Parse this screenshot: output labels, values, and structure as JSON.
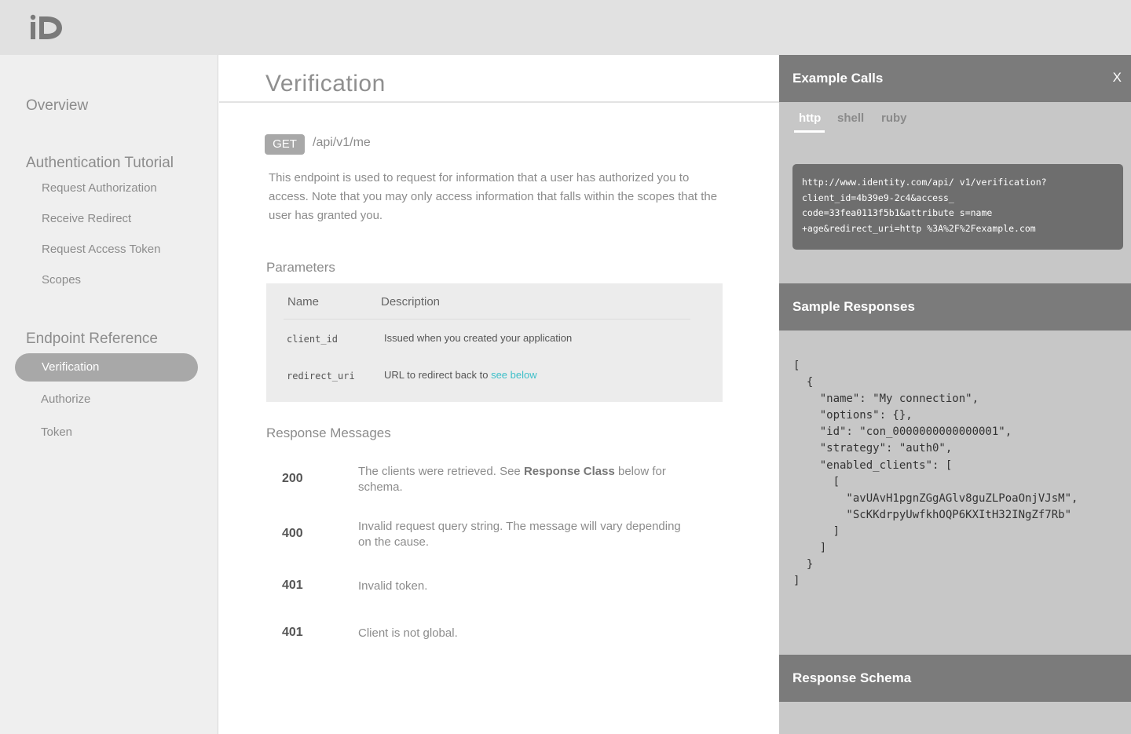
{
  "logo": {
    "text": "iD"
  },
  "sidebar": {
    "overview": "Overview",
    "auth_tutorial": {
      "heading": "Authentication Tutorial",
      "items": [
        "Request Authorization",
        "Receive Redirect",
        "Request Access Token",
        "Scopes"
      ]
    },
    "endpoint_reference": {
      "heading": "Endpoint Reference",
      "active": "Verification",
      "items": [
        "Authorize",
        "Token"
      ]
    }
  },
  "main": {
    "title": "Verification",
    "method": "GET",
    "endpoint": "/api/v1/me",
    "description": "This endpoint is used to request for information that a user has authorized you to access. Note that you may only access information that falls within the scopes that the user has granted you.",
    "parameters": {
      "heading": "Parameters",
      "columns": [
        "Name",
        "Description"
      ],
      "rows": [
        {
          "name": "client_id",
          "description": "Issued when you created your application",
          "link": ""
        },
        {
          "name": "redirect_uri",
          "description": "URL to redirect back to ",
          "link": "see below"
        }
      ]
    },
    "response_messages": {
      "heading": "Response Messages",
      "rows": [
        {
          "code": "200",
          "pre": "The clients were retrieved. See ",
          "bold": "Response Class",
          "post": " below for schema."
        },
        {
          "code": "400",
          "pre": "Invalid request query string. The message will vary depending on the cause.",
          "bold": "",
          "post": ""
        },
        {
          "code": "401",
          "pre": "Invalid token.",
          "bold": "",
          "post": ""
        },
        {
          "code": "401",
          "pre": "Client is not global.",
          "bold": "",
          "post": ""
        }
      ]
    }
  },
  "right_panel": {
    "example_calls": {
      "heading": "Example Calls",
      "close": "X",
      "tabs": [
        "http",
        "shell",
        "ruby"
      ],
      "active_tab": "http",
      "code": "http://www.identity.com/api/ v1/verification?\nclient_id=4b39e9-2c4&access_\ncode=33fea0113f5b1&attribute s=name\n+age&redirect_uri=http %3A%2F%2Fexample.com"
    },
    "sample_responses": {
      "heading": "Sample Responses",
      "json": "[\n  {\n    \"name\": \"My connection\",\n    \"options\": {},\n    \"id\": \"con_0000000000000001\",\n    \"strategy\": \"auth0\",\n    \"enabled_clients\": [\n      [\n        \"avUAvH1pgnZGgAGlv8guZLPoaOnjVJsM\",\n        \"ScKKdrpyUwfkhOQP6KXItH32INgZf7Rb\"\n      ]\n    ]\n  }\n]"
    },
    "response_schema": {
      "heading": "Response Schema"
    }
  },
  "colors": {
    "accent_link": "#3dbfc9",
    "active_nav": "#a8a8a8",
    "panel_header": "#7b7b7b"
  }
}
